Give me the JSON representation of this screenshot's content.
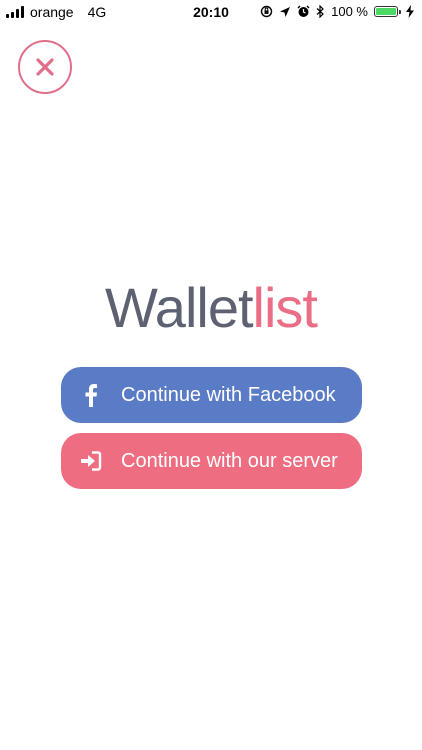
{
  "status_bar": {
    "carrier": "orange",
    "network": "4G",
    "time": "20:10",
    "battery_percent": "100 %",
    "icons": [
      "signal-icon",
      "orientation-lock-icon",
      "location-icon",
      "alarm-icon",
      "bluetooth-icon",
      "battery-icon",
      "charging-icon"
    ]
  },
  "close_button": {
    "icon": "close-icon",
    "color": "#e0708a"
  },
  "logo": {
    "part1": "Wallet",
    "part2": "list",
    "colors": {
      "part1": "#5e6171",
      "part2": "#e96e86"
    }
  },
  "buttons": {
    "facebook": {
      "label": "Continue with Facebook",
      "icon": "facebook-icon",
      "color": "#5a7bc5"
    },
    "server": {
      "label": "Continue with our server",
      "icon": "sign-in-icon",
      "color": "#ef6d80"
    }
  }
}
